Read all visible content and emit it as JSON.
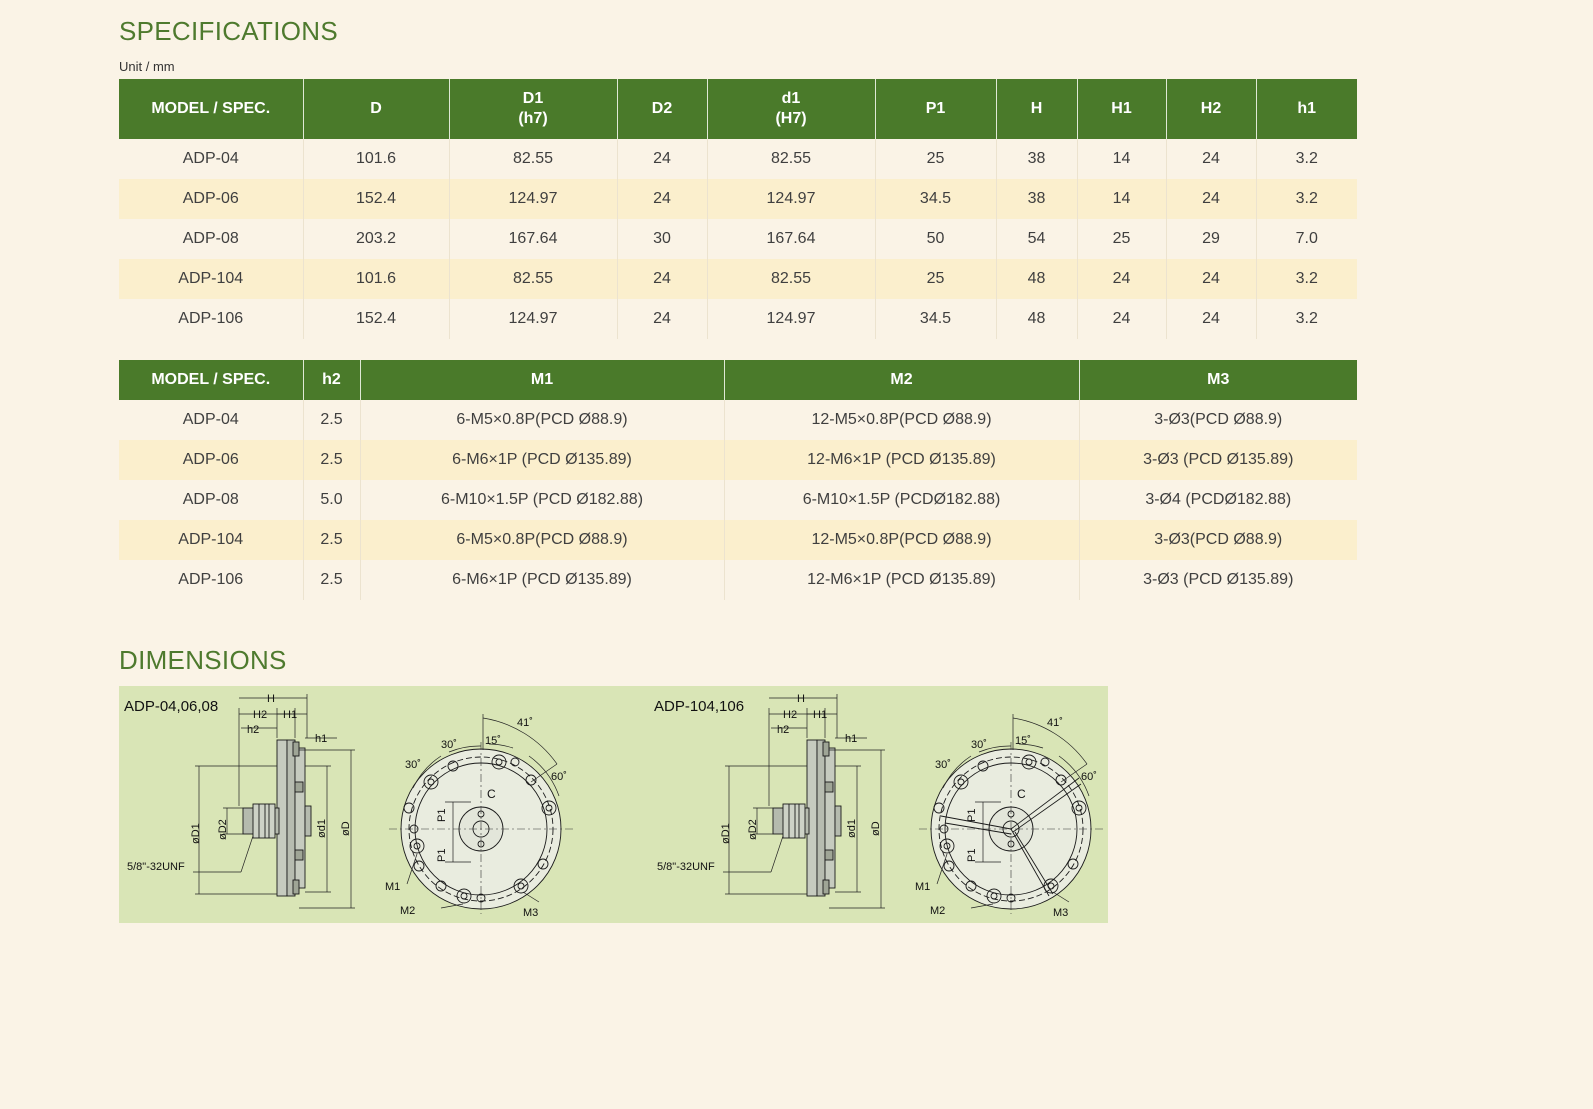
{
  "specifications": {
    "title": "SPECIFICATIONS",
    "unit": "Unit / mm",
    "table1": {
      "headers": [
        {
          "line1": "MODEL / SPEC.",
          "line2": ""
        },
        {
          "line1": "D",
          "line2": ""
        },
        {
          "line1": "D1",
          "line2": "(h7)"
        },
        {
          "line1": "D2",
          "line2": ""
        },
        {
          "line1": "d1",
          "line2": "(H7)"
        },
        {
          "line1": "P1",
          "line2": ""
        },
        {
          "line1": "H",
          "line2": ""
        },
        {
          "line1": "H1",
          "line2": ""
        },
        {
          "line1": "H2",
          "line2": ""
        },
        {
          "line1": "h1",
          "line2": ""
        }
      ],
      "rows": [
        [
          "ADP-04",
          "101.6",
          "82.55",
          "24",
          "82.55",
          "25",
          "38",
          "14",
          "24",
          "3.2"
        ],
        [
          "ADP-06",
          "152.4",
          "124.97",
          "24",
          "124.97",
          "34.5",
          "38",
          "14",
          "24",
          "3.2"
        ],
        [
          "ADP-08",
          "203.2",
          "167.64",
          "30",
          "167.64",
          "50",
          "54",
          "25",
          "29",
          "7.0"
        ],
        [
          "ADP-104",
          "101.6",
          "82.55",
          "24",
          "82.55",
          "25",
          "48",
          "24",
          "24",
          "3.2"
        ],
        [
          "ADP-106",
          "152.4",
          "124.97",
          "24",
          "124.97",
          "34.5",
          "48",
          "24",
          "24",
          "3.2"
        ]
      ]
    },
    "table2": {
      "headers": [
        "MODEL / SPEC.",
        "h2",
        "M1",
        "M2",
        "M3"
      ],
      "rows": [
        [
          "ADP-04",
          "2.5",
          "6-M5×0.8P(PCD Ø88.9)",
          "12-M5×0.8P(PCD Ø88.9)",
          "3-Ø3(PCD Ø88.9)"
        ],
        [
          "ADP-06",
          "2.5",
          "6-M6×1P (PCD Ø135.89)",
          "12-M6×1P (PCD Ø135.89)",
          "3-Ø3 (PCD Ø135.89)"
        ],
        [
          "ADP-08",
          "5.0",
          "6-M10×1.5P (PCD Ø182.88)",
          "6-M10×1.5P (PCDØ182.88)",
          "3-Ø4 (PCDØ182.88)"
        ],
        [
          "ADP-104",
          "2.5",
          "6-M5×0.8P(PCD Ø88.9)",
          "12-M5×0.8P(PCD Ø88.9)",
          "3-Ø3(PCD Ø88.9)"
        ],
        [
          "ADP-106",
          "2.5",
          "6-M6×1P (PCD Ø135.89)",
          "12-M6×1P (PCD Ø135.89)",
          "3-Ø3 (PCD Ø135.89)"
        ]
      ]
    }
  },
  "dimensions": {
    "title": "DIMENSIONS",
    "drawings": [
      {
        "model_label": "ADP-04,06,08",
        "side_labels": {
          "H": "H",
          "H2": "H2",
          "H1": "H1",
          "h2": "h2",
          "h1": "h1",
          "oD1": "øD1",
          "oD2": "øD2",
          "od1": "ød1",
          "oD": "øD",
          "thread": "5/8\"-32UNF"
        },
        "front_labels": {
          "a41": "41˚",
          "a15": "15˚",
          "a30a": "30˚",
          "a30b": "30˚",
          "a60": "60˚",
          "C": "C",
          "P1a": "P1",
          "P1b": "P1",
          "M1": "M1",
          "M2": "M2",
          "M3": "M3"
        }
      },
      {
        "model_label": "ADP-104,106",
        "side_labels": {
          "H": "H",
          "H2": "H2",
          "H1": "H1",
          "h2": "h2",
          "h1": "h1",
          "oD1": "øD1",
          "oD2": "øD2",
          "od1": "ød1",
          "oD": "øD",
          "thread": "5/8\"-32UNF"
        },
        "front_labels": {
          "a41": "41˚",
          "a15": "15˚",
          "a30a": "30˚",
          "a30b": "30˚",
          "a60": "60˚",
          "C": "C",
          "P1a": "P1",
          "P1b": "P1",
          "M1": "M1",
          "M2": "M2",
          "M3": "M3"
        }
      }
    ]
  }
}
